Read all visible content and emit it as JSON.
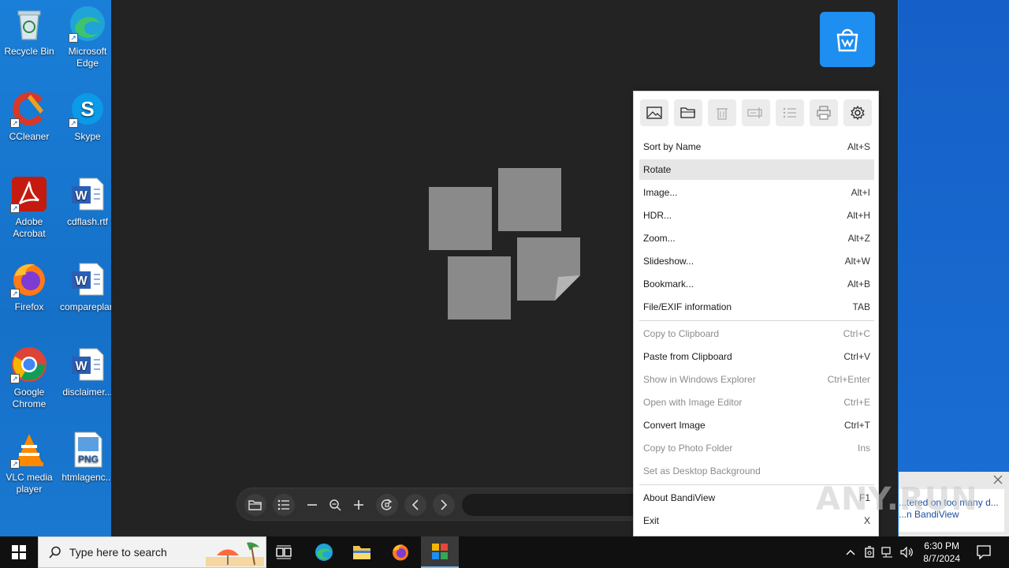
{
  "desktop": {
    "icons": [
      {
        "label": "Recycle Bin",
        "icon": "recycle-bin-icon"
      },
      {
        "label": "Microsoft Edge",
        "icon": "edge-icon"
      },
      {
        "label": "CCleaner",
        "icon": "ccleaner-icon"
      },
      {
        "label": "Skype",
        "icon": "skype-icon"
      },
      {
        "label": "Adobe Acrobat",
        "icon": "acrobat-icon"
      },
      {
        "label": "cdflash.rtf",
        "icon": "word-doc-icon"
      },
      {
        "label": "Firefox",
        "icon": "firefox-icon"
      },
      {
        "label": "compareplan...",
        "icon": "word-doc-icon"
      },
      {
        "label": "Google Chrome",
        "icon": "chrome-icon"
      },
      {
        "label": "disclaimer...",
        "icon": "word-doc-icon"
      },
      {
        "label": "VLC media player",
        "icon": "vlc-icon"
      },
      {
        "label": "htmlagenc...",
        "icon": "png-file-icon"
      }
    ]
  },
  "menu": {
    "toolbar": [
      "image-icon",
      "folder-icon",
      "trash-icon",
      "rename-icon",
      "list-icon",
      "print-icon",
      "gear-icon"
    ],
    "items": [
      {
        "label": "Sort by Name",
        "key": "Alt+S",
        "disabled": false
      },
      {
        "label": "Rotate",
        "key": "",
        "disabled": false,
        "highlighted": true
      },
      {
        "label": "Image...",
        "key": "Alt+I",
        "disabled": false
      },
      {
        "label": "HDR...",
        "key": "Alt+H",
        "disabled": false
      },
      {
        "label": "Zoom...",
        "key": "Alt+Z",
        "disabled": false
      },
      {
        "label": "Slideshow...",
        "key": "Alt+W",
        "disabled": false
      },
      {
        "label": "Bookmark...",
        "key": "Alt+B",
        "disabled": false
      },
      {
        "label": "File/EXIF information",
        "key": "TAB",
        "disabled": false
      },
      {
        "label": "Copy to Clipboard",
        "key": "Ctrl+C",
        "disabled": true
      },
      {
        "label": "Paste from Clipboard",
        "key": "Ctrl+V",
        "disabled": false
      },
      {
        "label": "Show in Windows Explorer",
        "key": "Ctrl+Enter",
        "disabled": true
      },
      {
        "label": "Open with Image Editor",
        "key": "Ctrl+E",
        "disabled": true
      },
      {
        "label": "Convert Image",
        "key": "Ctrl+T",
        "disabled": false
      },
      {
        "label": "Copy to Photo Folder",
        "key": "Ins",
        "disabled": true
      },
      {
        "label": "Set as Desktop Background",
        "key": "",
        "disabled": true
      },
      {
        "label": "About BandiView",
        "key": "F1",
        "disabled": false
      },
      {
        "label": "Exit",
        "key": "X",
        "disabled": false
      }
    ]
  },
  "notification": {
    "line1": "...tered on too many d...",
    "line2": "...n BandiView"
  },
  "watermark": "ANY.RUN",
  "taskbar": {
    "search_placeholder": "Type here to search",
    "time": "6:30 PM",
    "date": "8/7/2024"
  },
  "colors": {
    "accent": "#1e8ef0",
    "viewer_bg": "#232323",
    "desktop_bg": "#1a7fd8"
  }
}
